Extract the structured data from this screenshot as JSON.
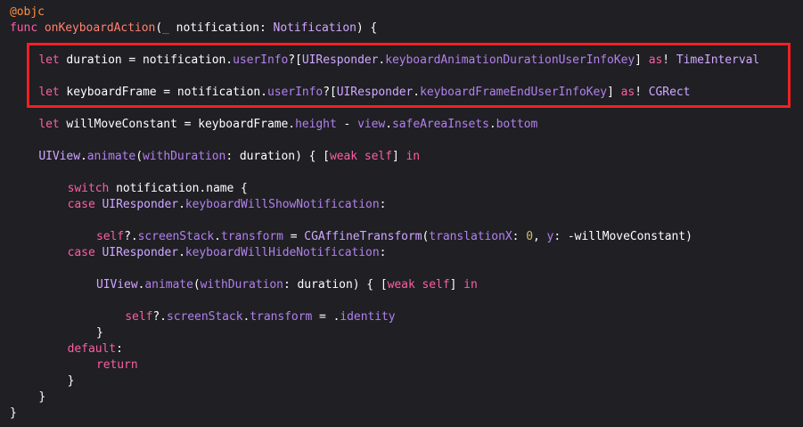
{
  "editor": {
    "language": "swift",
    "theme_colors": {
      "background": "#1f1f24",
      "keyword": "#fc5fa3",
      "attribute": "#fd8f3f",
      "function_decl": "#ff8170",
      "type": "#d0a8ff",
      "property": "#b281eb",
      "number": "#d0bf69",
      "plain": "#ffffff",
      "highlight_border": "#f2201f"
    },
    "lines": [
      {
        "indent": 0,
        "tokens": [
          {
            "t": "@objc",
            "c": "at"
          }
        ]
      },
      {
        "indent": 0,
        "tokens": [
          {
            "t": "func",
            "c": "kw"
          },
          {
            "t": " ",
            "c": "pl"
          },
          {
            "t": "onKeyboardAction",
            "c": "fn"
          },
          {
            "t": "(",
            "c": "pl"
          },
          {
            "t": "_",
            "c": "kw"
          },
          {
            "t": " notification: ",
            "c": "pl"
          },
          {
            "t": "Notification",
            "c": "ty"
          },
          {
            "t": ") {",
            "c": "pl"
          }
        ]
      },
      {
        "indent": 4,
        "tokens": [
          {
            "t": "let",
            "c": "kw"
          },
          {
            "t": " duration = notification.",
            "c": "pl"
          },
          {
            "t": "userInfo",
            "c": "pr"
          },
          {
            "t": "?[",
            "c": "pl"
          },
          {
            "t": "UIResponder",
            "c": "ty"
          },
          {
            "t": ".",
            "c": "pl"
          },
          {
            "t": "keyboardAnimationDurationUserInfoKey",
            "c": "pr"
          },
          {
            "t": "] ",
            "c": "pl"
          },
          {
            "t": "as",
            "c": "kw"
          },
          {
            "t": "! ",
            "c": "pl"
          },
          {
            "t": "TimeInterval",
            "c": "ty"
          }
        ]
      },
      {
        "indent": 4,
        "tokens": [
          {
            "t": "let",
            "c": "kw"
          },
          {
            "t": " keyboardFrame = notification.",
            "c": "pl"
          },
          {
            "t": "userInfo",
            "c": "pr"
          },
          {
            "t": "?[",
            "c": "pl"
          },
          {
            "t": "UIResponder",
            "c": "ty"
          },
          {
            "t": ".",
            "c": "pl"
          },
          {
            "t": "keyboardFrameEndUserInfoKey",
            "c": "pr"
          },
          {
            "t": "] ",
            "c": "pl"
          },
          {
            "t": "as",
            "c": "kw"
          },
          {
            "t": "! ",
            "c": "pl"
          },
          {
            "t": "CGRect",
            "c": "ty"
          }
        ]
      },
      {
        "indent": 4,
        "tokens": [
          {
            "t": "let",
            "c": "kw"
          },
          {
            "t": " willMoveConstant = keyboardFrame.",
            "c": "pl"
          },
          {
            "t": "height",
            "c": "pr"
          },
          {
            "t": " - ",
            "c": "pl"
          },
          {
            "t": "view",
            "c": "pr"
          },
          {
            "t": ".",
            "c": "pl"
          },
          {
            "t": "safeAreaInsets",
            "c": "pr"
          },
          {
            "t": ".",
            "c": "pl"
          },
          {
            "t": "bottom",
            "c": "pr"
          }
        ]
      },
      {
        "indent": 4,
        "tokens": [
          {
            "t": "UIView",
            "c": "ty"
          },
          {
            "t": ".",
            "c": "pl"
          },
          {
            "t": "animate",
            "c": "pr"
          },
          {
            "t": "(",
            "c": "pl"
          },
          {
            "t": "withDuration",
            "c": "pr"
          },
          {
            "t": ": duration) { [",
            "c": "pl"
          },
          {
            "t": "weak",
            "c": "kw"
          },
          {
            "t": " ",
            "c": "pl"
          },
          {
            "t": "self",
            "c": "kw"
          },
          {
            "t": "] ",
            "c": "pl"
          },
          {
            "t": "in",
            "c": "kw"
          }
        ]
      },
      {
        "indent": 8,
        "tokens": [
          {
            "t": "switch",
            "c": "kw"
          },
          {
            "t": " notification.name {",
            "c": "pl"
          }
        ]
      },
      {
        "indent": 8,
        "tokens": [
          {
            "t": "case",
            "c": "kw"
          },
          {
            "t": " ",
            "c": "pl"
          },
          {
            "t": "UIResponder",
            "c": "ty"
          },
          {
            "t": ".",
            "c": "pl"
          },
          {
            "t": "keyboardWillShowNotification",
            "c": "pr"
          },
          {
            "t": ":",
            "c": "pl"
          }
        ]
      },
      {
        "indent": 12,
        "tokens": [
          {
            "t": "self",
            "c": "kw"
          },
          {
            "t": "?.",
            "c": "pl"
          },
          {
            "t": "screenStack",
            "c": "pr"
          },
          {
            "t": ".",
            "c": "pl"
          },
          {
            "t": "transform",
            "c": "pr"
          },
          {
            "t": " = ",
            "c": "pl"
          },
          {
            "t": "CGAffineTransform",
            "c": "ty"
          },
          {
            "t": "(",
            "c": "pl"
          },
          {
            "t": "translationX",
            "c": "pr"
          },
          {
            "t": ": ",
            "c": "pl"
          },
          {
            "t": "0",
            "c": "num"
          },
          {
            "t": ", ",
            "c": "pl"
          },
          {
            "t": "y",
            "c": "pr"
          },
          {
            "t": ": -willMoveConstant)",
            "c": "pl"
          }
        ]
      },
      {
        "indent": 8,
        "tokens": [
          {
            "t": "case",
            "c": "kw"
          },
          {
            "t": " ",
            "c": "pl"
          },
          {
            "t": "UIResponder",
            "c": "ty"
          },
          {
            "t": ".",
            "c": "pl"
          },
          {
            "t": "keyboardWillHideNotification",
            "c": "pr"
          },
          {
            "t": ":",
            "c": "pl"
          }
        ]
      },
      {
        "indent": 12,
        "tokens": [
          {
            "t": "UIView",
            "c": "ty"
          },
          {
            "t": ".",
            "c": "pl"
          },
          {
            "t": "animate",
            "c": "pr"
          },
          {
            "t": "(",
            "c": "pl"
          },
          {
            "t": "withDuration",
            "c": "pr"
          },
          {
            "t": ": duration) { [",
            "c": "pl"
          },
          {
            "t": "weak",
            "c": "kw"
          },
          {
            "t": " ",
            "c": "pl"
          },
          {
            "t": "self",
            "c": "kw"
          },
          {
            "t": "] ",
            "c": "pl"
          },
          {
            "t": "in",
            "c": "kw"
          }
        ]
      },
      {
        "indent": 16,
        "tokens": [
          {
            "t": "self",
            "c": "kw"
          },
          {
            "t": "?.",
            "c": "pl"
          },
          {
            "t": "screenStack",
            "c": "pr"
          },
          {
            "t": ".",
            "c": "pl"
          },
          {
            "t": "transform",
            "c": "pr"
          },
          {
            "t": " = .",
            "c": "pl"
          },
          {
            "t": "identity",
            "c": "pr"
          }
        ]
      },
      {
        "indent": 12,
        "tokens": [
          {
            "t": "}",
            "c": "pl"
          }
        ]
      },
      {
        "indent": 8,
        "tokens": [
          {
            "t": "default",
            "c": "kw"
          },
          {
            "t": ":",
            "c": "pl"
          }
        ]
      },
      {
        "indent": 12,
        "tokens": [
          {
            "t": "return",
            "c": "kw"
          }
        ]
      },
      {
        "indent": 8,
        "tokens": [
          {
            "t": "}",
            "c": "pl"
          }
        ]
      },
      {
        "indent": 4,
        "tokens": [
          {
            "t": "}",
            "c": "pl"
          }
        ]
      },
      {
        "indent": 0,
        "tokens": [
          {
            "t": "}",
            "c": "pl"
          }
        ]
      }
    ]
  }
}
